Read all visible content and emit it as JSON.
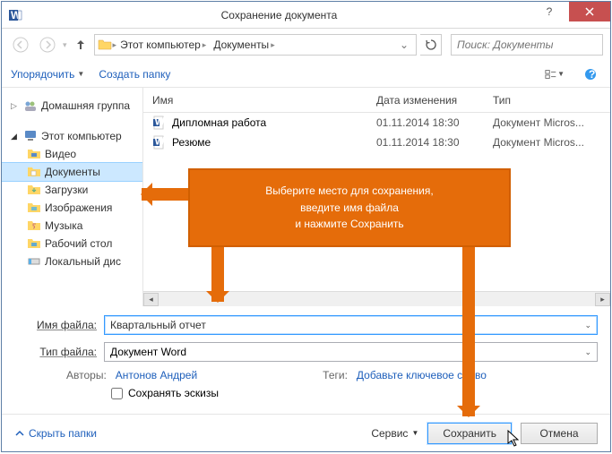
{
  "title": "Сохранение документа",
  "breadcrumb": {
    "root": "Этот компьютер",
    "current": "Документы"
  },
  "search": {
    "placeholder": "Поиск: Документы"
  },
  "toolbar": {
    "organize": "Упорядочить",
    "new_folder": "Создать папку"
  },
  "sidebar": {
    "homegroup": "Домашняя группа",
    "thispc": "Этот компьютер",
    "items": [
      "Видео",
      "Документы",
      "Загрузки",
      "Изображения",
      "Музыка",
      "Рабочий стол",
      "Локальный дис"
    ]
  },
  "columns": {
    "name": "Имя",
    "date": "Дата изменения",
    "type": "Тип"
  },
  "files": [
    {
      "name": "Дипломная работа",
      "date": "01.11.2014 18:30",
      "type": "Документ Micros..."
    },
    {
      "name": "Резюме",
      "date": "01.11.2014 18:30",
      "type": "Документ Micros..."
    }
  ],
  "filename": {
    "label": "Имя файла:",
    "value": "Квартальный отчет"
  },
  "filetype": {
    "label": "Тип файла:",
    "value": "Документ Word"
  },
  "meta": {
    "authors_label": "Авторы:",
    "authors_value": "Антонов Андрей",
    "tags_label": "Теги:",
    "tags_value": "Добавьте ключевое слово"
  },
  "thumbs": "Сохранять эскизы",
  "footer": {
    "hide": "Скрыть папки",
    "tools": "Сервис",
    "save": "Сохранить",
    "cancel": "Отмена"
  },
  "callout": {
    "l1": "Выберите место для сохранения,",
    "l2": "введите имя файла",
    "l3": "и нажмите Сохранить"
  }
}
